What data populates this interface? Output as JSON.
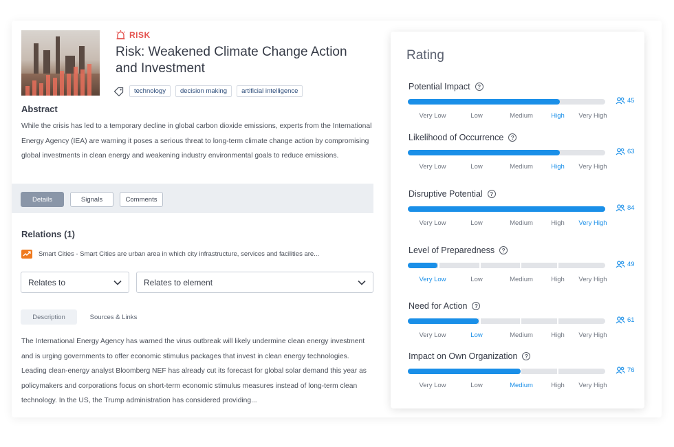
{
  "risk": {
    "tag_label": "RISK",
    "title": "Risk: Weakened Climate Change Action and Investment",
    "tags": [
      "technology",
      "decision making",
      "artificial intelligence"
    ]
  },
  "abstract": {
    "heading": "Abstract",
    "text": "While the crisis has led to a temporary decline in global carbon dioxide emissions, experts from the International Energy Agency (IEA) are warning it poses a serious threat to long-term climate change action by compromising global investments in clean energy and weakening industry environmental goals to reduce emissions."
  },
  "tabs": [
    {
      "label": "Details",
      "active": true
    },
    {
      "label": "Signals",
      "active": false
    },
    {
      "label": "Comments",
      "active": false
    }
  ],
  "relations": {
    "heading": "Relations (1)",
    "item": "Smart Cities - Smart Cities are urban area in which city infrastructure, services and facilities are...",
    "relates_to": "Relates to",
    "relates_to_element": "Relates to element"
  },
  "subtabs": [
    {
      "label": "Description",
      "active": true
    },
    {
      "label": "Sources & Links",
      "active": false
    }
  ],
  "description": "The International Energy Agency has warned the virus outbreak will likely undermine clean energy investment and is urging governments to offer economic stimulus packages that invest in clean energy technologies. Leading clean-energy analyst Bloomberg NEF has already cut its forecast for global solar demand this year as policymakers and corporations focus on short-term economic stimulus measures instead of long-term clean technology. In the US, the Trump administration has considered providing...",
  "rating": {
    "heading": "Rating",
    "levels": [
      "Very Low",
      "Low",
      "Medium",
      "High",
      "Very High"
    ],
    "accent_color": "#1a8fe8",
    "criteria": [
      {
        "label": "Potential Impact",
        "fill": 0.77,
        "selected": 3,
        "count": "45"
      },
      {
        "label": "Likelihood of Occurrence",
        "fill": 0.77,
        "selected": 3,
        "count": "63"
      },
      {
        "label": "Disruptive Potential",
        "fill": 1.0,
        "selected": 4,
        "count": "84"
      },
      {
        "label": "Level of Preparedness",
        "fill": 0.15,
        "selected": 0,
        "count": "49"
      },
      {
        "label": "Need for Action",
        "fill": 0.36,
        "selected": 1,
        "count": "61"
      },
      {
        "label": "Impact on Own Organization",
        "fill": 0.57,
        "selected": 2,
        "count": "76"
      }
    ]
  }
}
